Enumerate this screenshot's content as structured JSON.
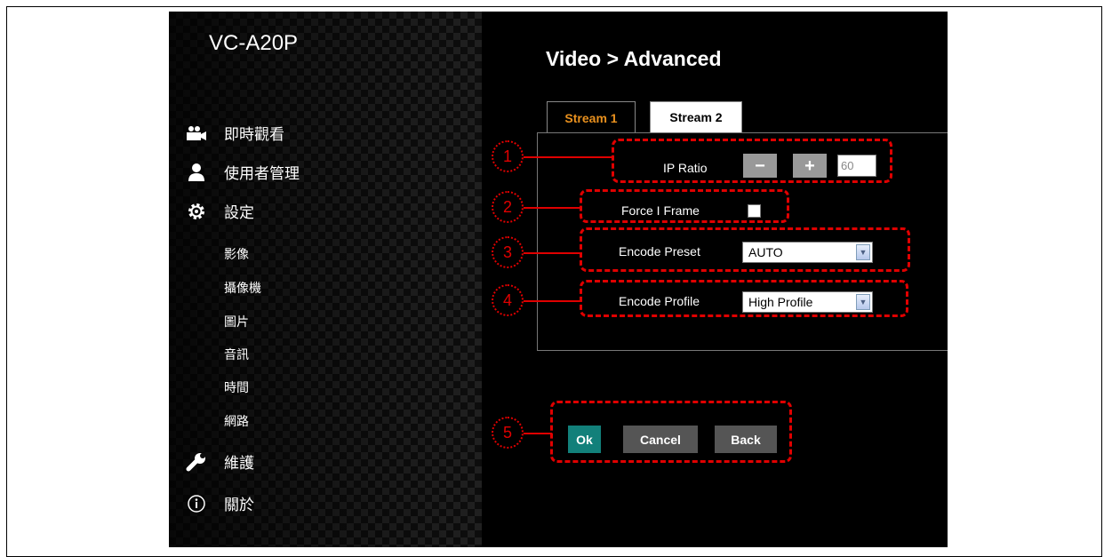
{
  "sidebar": {
    "brand": "VC-A20P",
    "main_items": [
      {
        "label": "即時觀看",
        "icon": "camera-icon"
      },
      {
        "label": "使用者管理",
        "icon": "user-icon"
      },
      {
        "label": "設定",
        "icon": "gear-icon"
      },
      {
        "label": "維護",
        "icon": "wrench-icon"
      },
      {
        "label": "關於",
        "icon": "info-icon"
      }
    ],
    "sub_items": [
      "影像",
      "攝像機",
      "圖片",
      "音訊",
      "時間",
      "網路"
    ]
  },
  "page": {
    "title": "Video > Advanced"
  },
  "tabs": [
    {
      "label": "Stream 1",
      "active": true
    },
    {
      "label": "Stream 2",
      "active": false
    }
  ],
  "form": {
    "ip_ratio": {
      "label": "IP Ratio",
      "minus": "−",
      "plus": "+",
      "value": "60"
    },
    "force_i_frame": {
      "label": "Force I Frame",
      "checked": false
    },
    "encode_preset": {
      "label": "Encode Preset",
      "value": "AUTO"
    },
    "encode_profile": {
      "label": "Encode Profile",
      "value": "High Profile"
    }
  },
  "actions": {
    "ok": "Ok",
    "cancel": "Cancel",
    "back": "Back"
  },
  "callouts": [
    "1",
    "2",
    "3",
    "4",
    "5"
  ],
  "colors": {
    "accent_tab": "#e8901e",
    "ok_button": "#12807a",
    "annotation": "#e00000"
  }
}
